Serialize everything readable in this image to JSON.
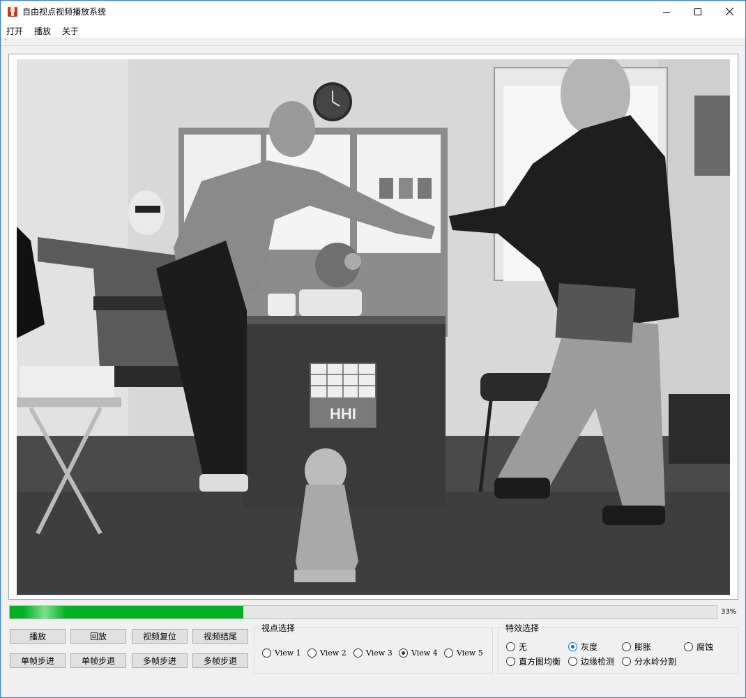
{
  "window": {
    "title": "自由视点视频播放系统"
  },
  "menu": [
    "打开",
    "播放",
    "关于"
  ],
  "video": {
    "sign_text": "HHI"
  },
  "progress": {
    "value": 0.33,
    "label": "33%"
  },
  "buttons": {
    "row1": [
      "播放",
      "回放",
      "视频复位",
      "视频结尾"
    ],
    "row2": [
      "单帧步进",
      "单帧步退",
      "多帧步进",
      "多帧步退"
    ]
  },
  "view_group": {
    "title": "视点选择",
    "options": [
      "View 1",
      "View 2",
      "View 3",
      "View 4",
      "View 5"
    ],
    "selected": "View 4"
  },
  "effect_group": {
    "title": "特效选择",
    "options": [
      "无",
      "灰度",
      "膨胀",
      "腐蚀",
      "直方图均衡",
      "边缘检测",
      "分水岭分割"
    ],
    "selected": "灰度"
  },
  "colors": {
    "progress": "#06b025",
    "accent": "#0078d7",
    "window_border": "#2b7bd8"
  },
  "icons": {
    "app": "app-icon",
    "minimize": "minimize-icon",
    "maximize": "maximize-icon",
    "close": "close-icon"
  }
}
